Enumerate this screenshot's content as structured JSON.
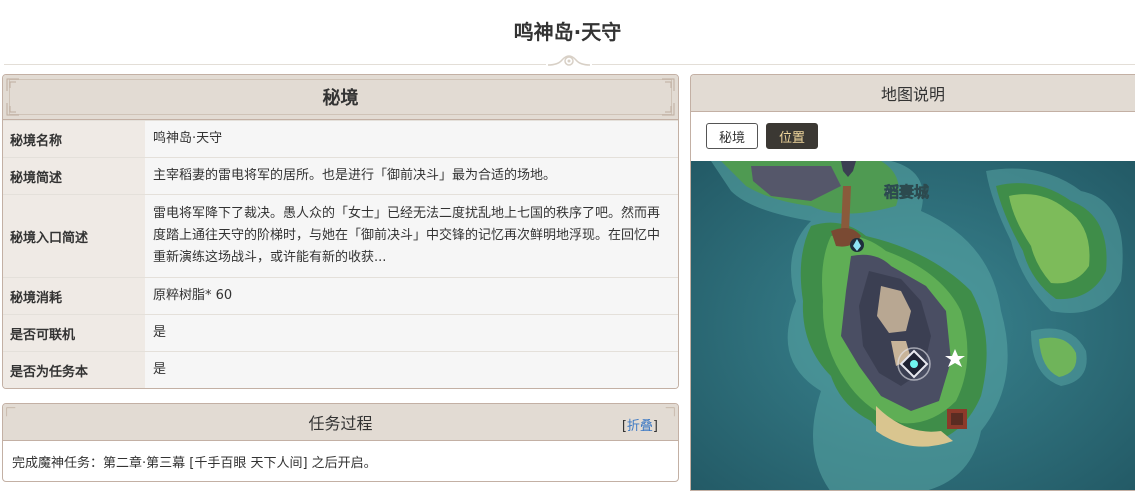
{
  "page_title": "鸣神岛·天守",
  "info": {
    "title": "秘境",
    "rows": [
      {
        "label": "秘境名称",
        "value": "鸣神岛·天守"
      },
      {
        "label": "秘境简述",
        "value": "主宰稻妻的雷电将军的居所。也是进行「御前决斗」最为合适的场地。"
      },
      {
        "label": "秘境入口简述",
        "value": "雷电将军降下了裁决。愚人众的「女士」已经无法二度扰乱地上七国的秩序了吧。然而再度踏上通往天守的阶梯时，与她在「御前决斗」中交锋的记忆再次鲜明地浮现。在回忆中重新演练这场战斗，或许能有新的收获..."
      },
      {
        "label": "秘境消耗",
        "value": "原粹树脂* 60"
      },
      {
        "label": "是否可联机",
        "value": "是"
      },
      {
        "label": "是否为任务本",
        "value": "是"
      }
    ]
  },
  "quest": {
    "title": "任务过程",
    "collapse_open": "[",
    "collapse_label": "折叠",
    "collapse_close": "]",
    "text": "完成魔神任务：第二章·第三幕 [千手百眼 天下人间] 之后开启。"
  },
  "map": {
    "title": "地图说明",
    "tabs": [
      {
        "label": "秘境",
        "active": false
      },
      {
        "label": "位置",
        "active": true
      }
    ],
    "place_label": "稻妻城"
  },
  "colors": {
    "header_bg": "#e2dbd3",
    "border": "#c3b0a4",
    "label_bg": "#efeae5",
    "value_bg": "#f6f6f6",
    "link": "#3b78c4",
    "active_tab_bg": "#3b3833",
    "active_tab_text": "#f1d79c",
    "sea": "#2f6f7a"
  }
}
